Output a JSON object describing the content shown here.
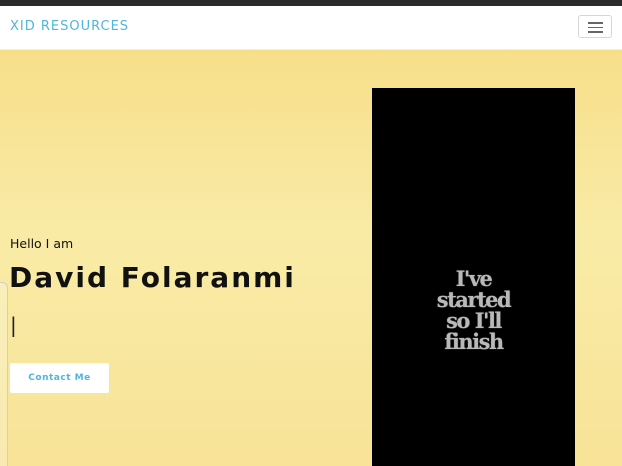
{
  "navbar": {
    "brand": "XID RESOURCES",
    "toggle_icon": "hamburger-menu-icon"
  },
  "hero": {
    "greeting": "Hello I am",
    "name": "David Folaranmi",
    "typed_cursor": "|",
    "contact_label": "Contact Me",
    "poster_lines": [
      "I've",
      "started",
      "so I'll",
      "finish"
    ]
  },
  "colors": {
    "brand": "#4fb6dc",
    "hero_gradient_top": "#f7df8a",
    "hero_gradient_bottom": "#f8e397",
    "poster_background": "#000000"
  }
}
